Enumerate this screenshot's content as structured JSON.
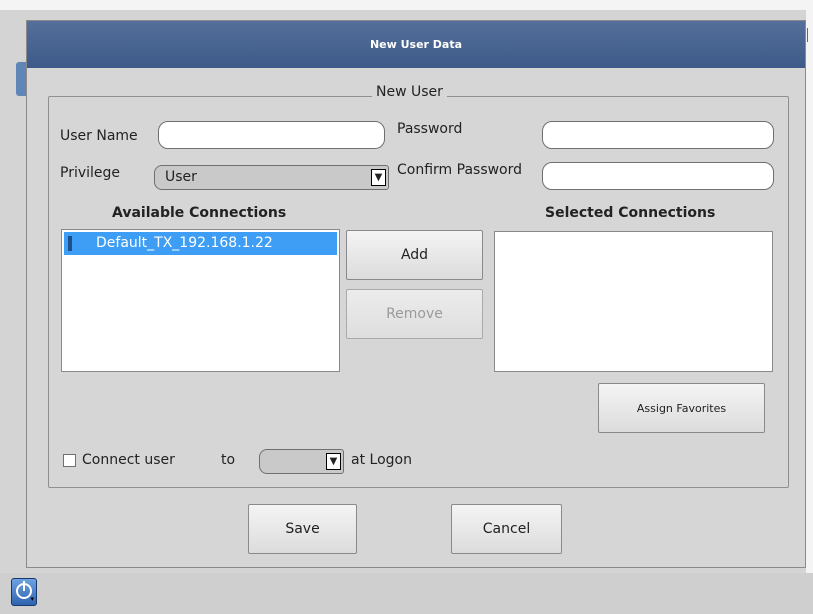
{
  "dialog": {
    "title": "New User Data",
    "group_title": "New User",
    "user_name_label": "User Name",
    "user_name_value": "",
    "password_label": "Password",
    "password_value": "",
    "privilege_label": "Privilege",
    "privilege_value": "User",
    "confirm_password_label": "Confirm Password",
    "confirm_password_value": "",
    "available_header": "Available Connections",
    "selected_header": "Selected Connections",
    "available_items": [
      "Default_TX_192.168.1.22"
    ],
    "selected_items": [],
    "add_label": "Add",
    "remove_label": "Remove",
    "assign_favorites_label": "Assign Favorites",
    "connect_user_label": "Connect user",
    "connect_user_checked": false,
    "to_label": "to",
    "connection_select_value": "",
    "at_logon_label": "at Logon",
    "save_label": "Save",
    "cancel_label": "Cancel"
  },
  "taskbar": {
    "start_icon": "power-icon"
  },
  "colors": {
    "titlebar": "#4a6894",
    "selection": "#3e9ef5",
    "dialog_bg": "#d6d6d6"
  }
}
